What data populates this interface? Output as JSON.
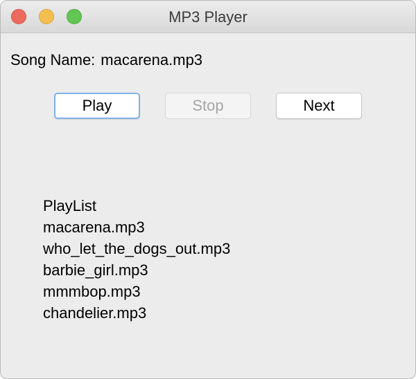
{
  "window": {
    "title": "MP3 Player"
  },
  "current_song": {
    "label": "Song Name:",
    "value": "macarena.mp3"
  },
  "controls": {
    "play_label": "Play",
    "stop_label": "Stop",
    "next_label": "Next"
  },
  "playlist": {
    "heading": "PlayList",
    "items": [
      "macarena.mp3",
      "who_let_the_dogs_out.mp3",
      "barbie_girl.mp3",
      "mmmbop.mp3",
      "chandelier.mp3"
    ]
  },
  "colors": {
    "close": "#ed6a5e",
    "minimize": "#f5bf4f",
    "zoom": "#62c554",
    "focus_ring": "#7fb2ea",
    "window_bg": "#ececec"
  }
}
